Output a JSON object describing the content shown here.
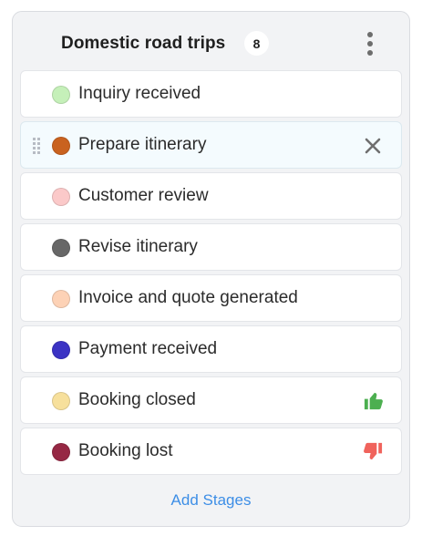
{
  "pipeline": {
    "title": "Domestic road trips",
    "count": "8",
    "add_label": "Add Stages"
  },
  "stages": [
    {
      "label": "Inquiry received",
      "color": "#c5f0b9"
    },
    {
      "label": "Prepare itinerary",
      "color": "#c9621f"
    },
    {
      "label": "Customer review",
      "color": "#fbc9c9"
    },
    {
      "label": "Revise itinerary",
      "color": "#676767"
    },
    {
      "label": "Invoice and quote generated",
      "color": "#fdd2b6"
    },
    {
      "label": "Payment received",
      "color": "#3b33c4"
    },
    {
      "label": "Booking closed",
      "color": "#f7e09c"
    },
    {
      "label": "Booking lost",
      "color": "#962844"
    }
  ],
  "icons": {
    "close": "close-icon",
    "won": "thumbs-up-icon",
    "lost": "thumbs-down-icon",
    "menu": "more-vertical-icon",
    "drag": "drag-handle-icon"
  },
  "colors": {
    "won": "#4caf50",
    "lost": "#f0635c",
    "link": "#3d8ee6"
  }
}
